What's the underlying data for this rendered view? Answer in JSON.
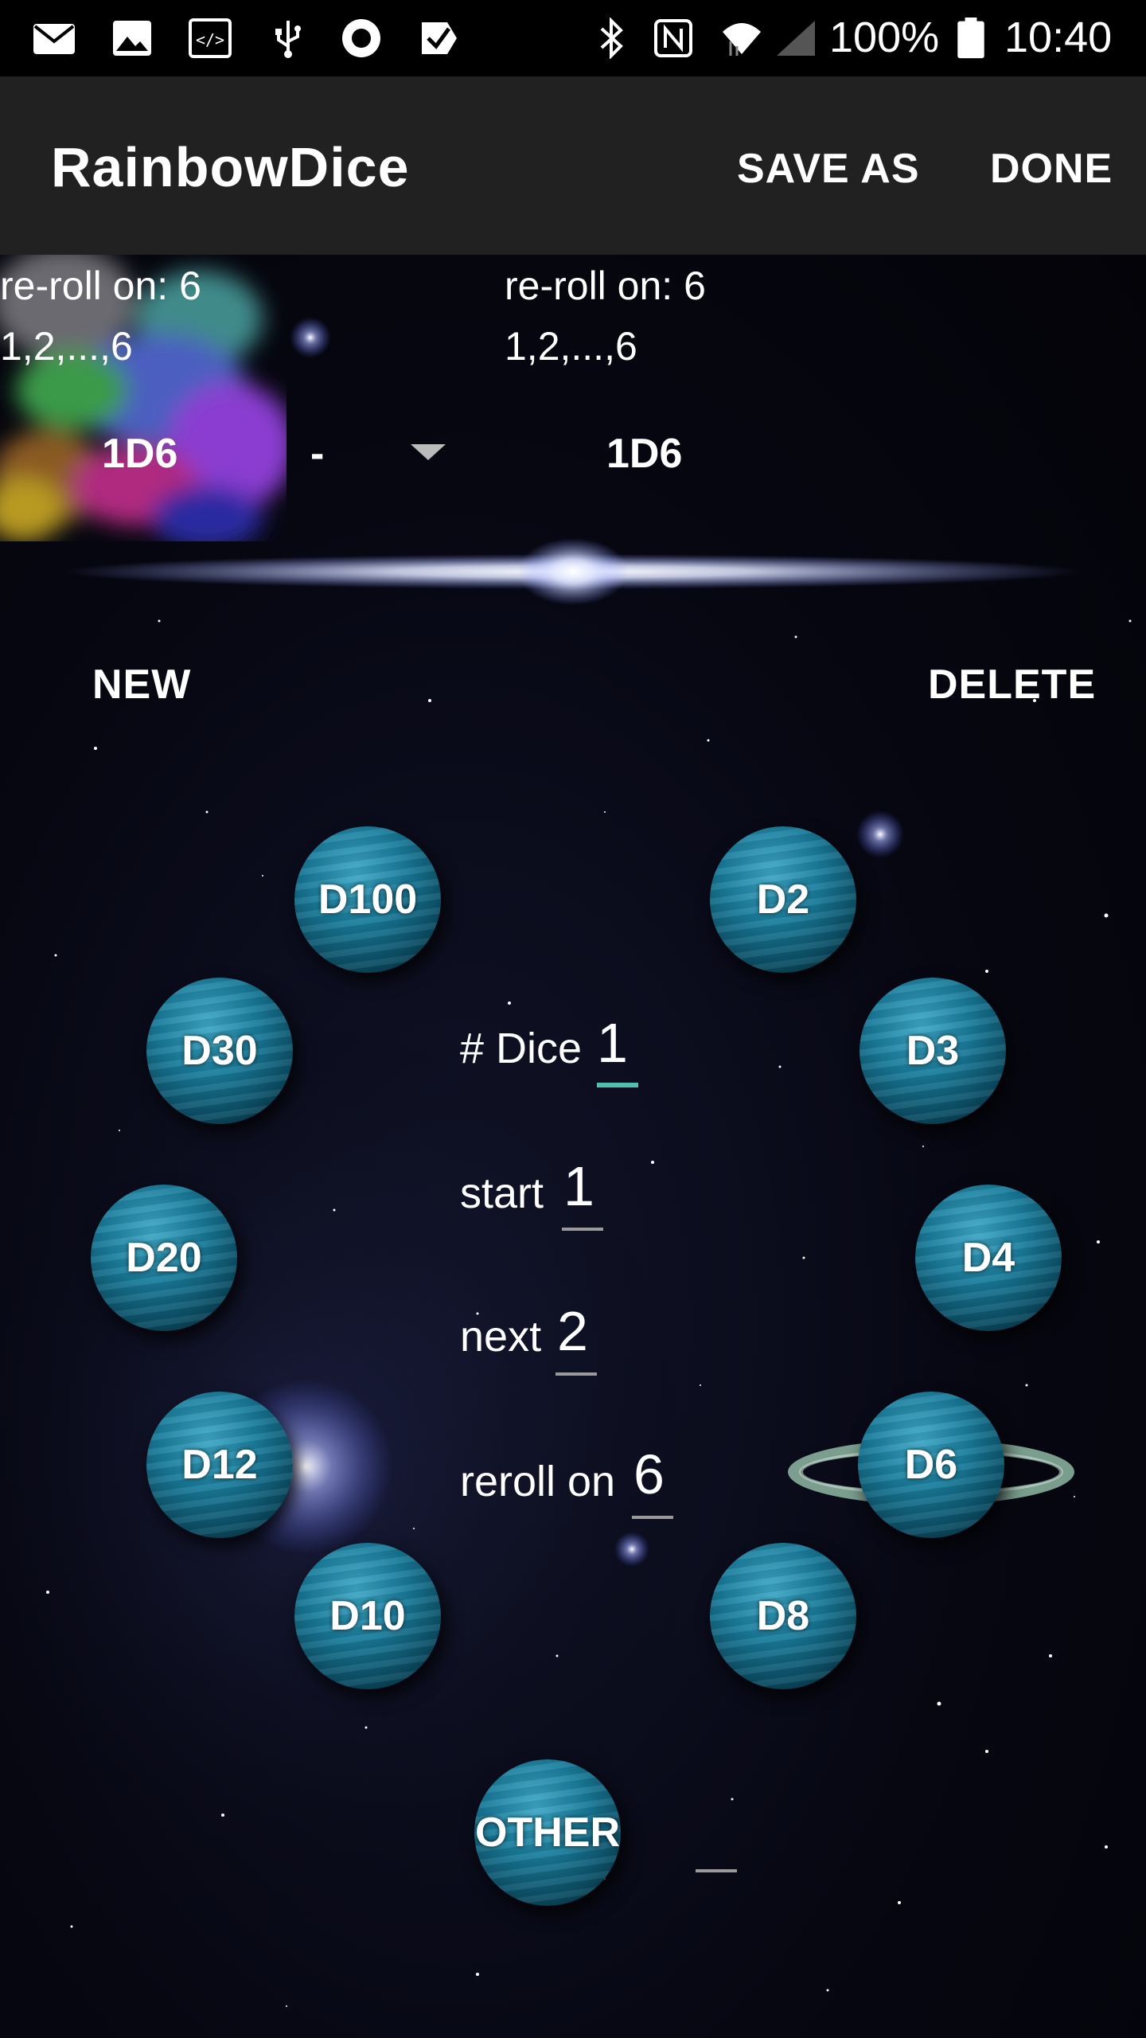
{
  "status_bar": {
    "icons": [
      "mail-icon",
      "image-icon",
      "code-icon",
      "usb-icon",
      "record-icon",
      "check-icon",
      "bluetooth-icon",
      "nfc-icon",
      "wifi-icon",
      "signal-icon",
      "battery-icon"
    ],
    "battery_text": "100%",
    "time": "10:40"
  },
  "app_bar": {
    "title": "RainbowDice",
    "save_as_label": "SAVE AS",
    "done_label": "DONE"
  },
  "summary": {
    "left": {
      "reroll": "re-roll on: 6",
      "sides": "1,2,...,6",
      "dice": "1D6"
    },
    "operator": "-",
    "right": {
      "reroll": "re-roll on: 6",
      "sides": "1,2,...,6",
      "dice": "1D6"
    }
  },
  "actions": {
    "new_label": "NEW",
    "delete_label": "DELETE"
  },
  "dice_buttons": {
    "d100": "D100",
    "d2": "D2",
    "d30": "D30",
    "d3": "D3",
    "d20": "D20",
    "d4": "D4",
    "d12": "D12",
    "d6": "D6",
    "d10": "D10",
    "d8": "D8",
    "other": "OTHER"
  },
  "selected_die": "D6",
  "fields": {
    "dice_count": {
      "label": "# Dice",
      "value": "1"
    },
    "start": {
      "label": "start",
      "value": "1"
    },
    "next": {
      "label": "next",
      "value": "2"
    },
    "reroll_on": {
      "label": "reroll on",
      "value": "6"
    }
  },
  "colors": {
    "app_bar": "#212121",
    "planet": "#1a7d9c",
    "active_underline": "#4ec0b0"
  }
}
